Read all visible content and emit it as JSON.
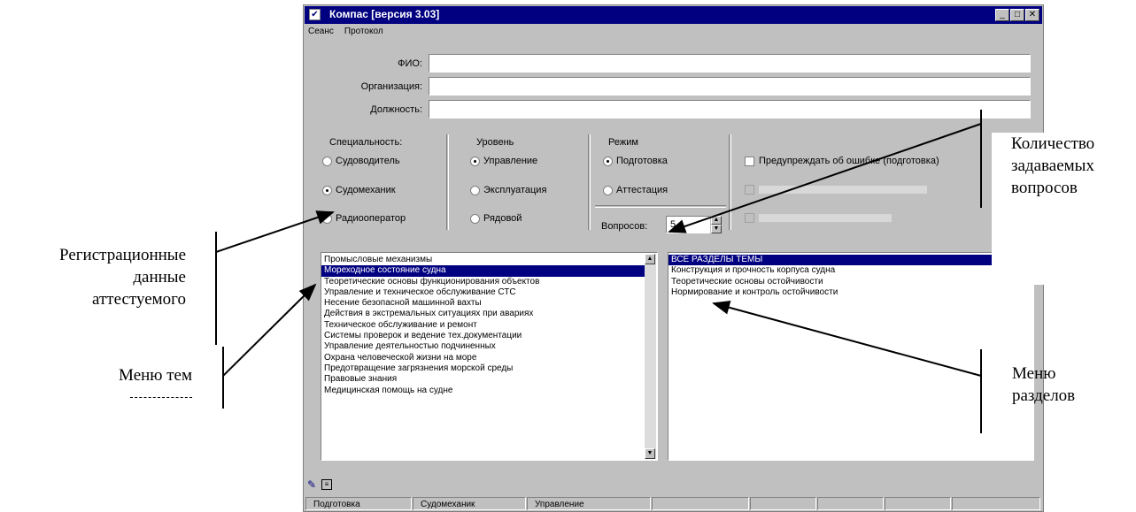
{
  "window": {
    "title": "Компас [версия 3.03]",
    "menu": [
      "Сеанс",
      "Протокол"
    ]
  },
  "registration": {
    "fio_label": "ФИО:",
    "org_label": "Организация:",
    "position_label": "Должность:"
  },
  "specialty": {
    "label": "Специальность:",
    "options": [
      "Судоводитель",
      "Судомеханик",
      "Радиооператор"
    ],
    "selected": "Судомеханик"
  },
  "level": {
    "label": "Уровень",
    "options": [
      "Управление",
      "Эксплуатация",
      "Рядовой"
    ],
    "selected": "Управление"
  },
  "mode": {
    "label": "Режим",
    "options": [
      "Подготовка",
      "Аттестация"
    ],
    "selected": "Подготовка",
    "questions_label": "Вопросов:",
    "questions_value": "5"
  },
  "flags": {
    "warn_label": "Предупреждать об ошибке (подготовка)"
  },
  "topics": {
    "items": [
      "Промысловые механизмы",
      "Мореходное состояние судна",
      "Теоретические основы функционирования объектов",
      "Управление и техническое обслуживание СТС",
      "Несение безопасной машинной вахты",
      "Действия в экстремальных ситуациях при авариях",
      "Техническое обслуживание и ремонт",
      "Системы проверок и ведение тех.документации",
      "Управление деятельностью подчиненных",
      "Охрана человеческой жизни на море",
      "Предотвращение загрязнения морской среды",
      "Правовые знания",
      "Медицинская помощь на судне"
    ],
    "selected": "Мореходное состояние судна"
  },
  "sections": {
    "items": [
      "ВСЕ РАЗДЕЛЫ ТЕМЫ",
      "Конструкция и прочность корпуса судна",
      "Теоретические основы остойчивости",
      "Нормирование и контроль остойчивости"
    ],
    "selected": "ВСЕ РАЗДЕЛЫ ТЕМЫ"
  },
  "statusbar": [
    "Подготовка",
    "Судомеханик",
    "Управление"
  ],
  "annotations": {
    "registration": [
      "Регистрационные",
      "данные",
      "аттестуемого"
    ],
    "topics_menu": "Меню тем",
    "questions_count": [
      "Количество",
      "задаваемых",
      "вопросов"
    ],
    "sections_menu": [
      "Меню",
      "разделов"
    ]
  }
}
